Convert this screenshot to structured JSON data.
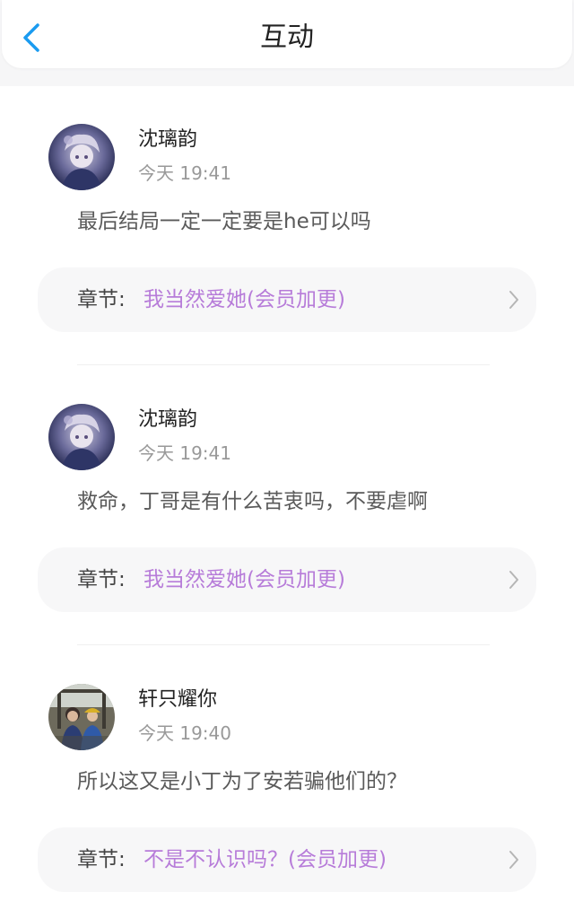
{
  "header": {
    "title": "互动",
    "back_icon": "chevron-left-icon",
    "accent_color": "#1a9bf0"
  },
  "comments": [
    {
      "username": "沈璃韵",
      "time": "今天 19:41",
      "text": "最后结局一定一定要是he可以吗",
      "chapter_label": "章节:",
      "chapter_title": "我当然爱她(会员加更)",
      "avatar": "anime-girl-avatar"
    },
    {
      "username": "沈璃韵",
      "time": "今天 19:41",
      "text": "救命，丁哥是有什么苦衷吗，不要虐啊",
      "chapter_label": "章节:",
      "chapter_title": "我当然爱她(会员加更)",
      "avatar": "anime-girl-avatar"
    },
    {
      "username": "轩只耀你",
      "time": "今天 19:40",
      "text": "所以这又是小丁为了安若骗他们的？",
      "chapter_label": "章节:",
      "chapter_title": "不是不认识吗？(会员加更)",
      "avatar": "photo-two-people-avatar"
    }
  ],
  "colors": {
    "chapter_link": "#b77cd9",
    "time_text": "#999999"
  }
}
